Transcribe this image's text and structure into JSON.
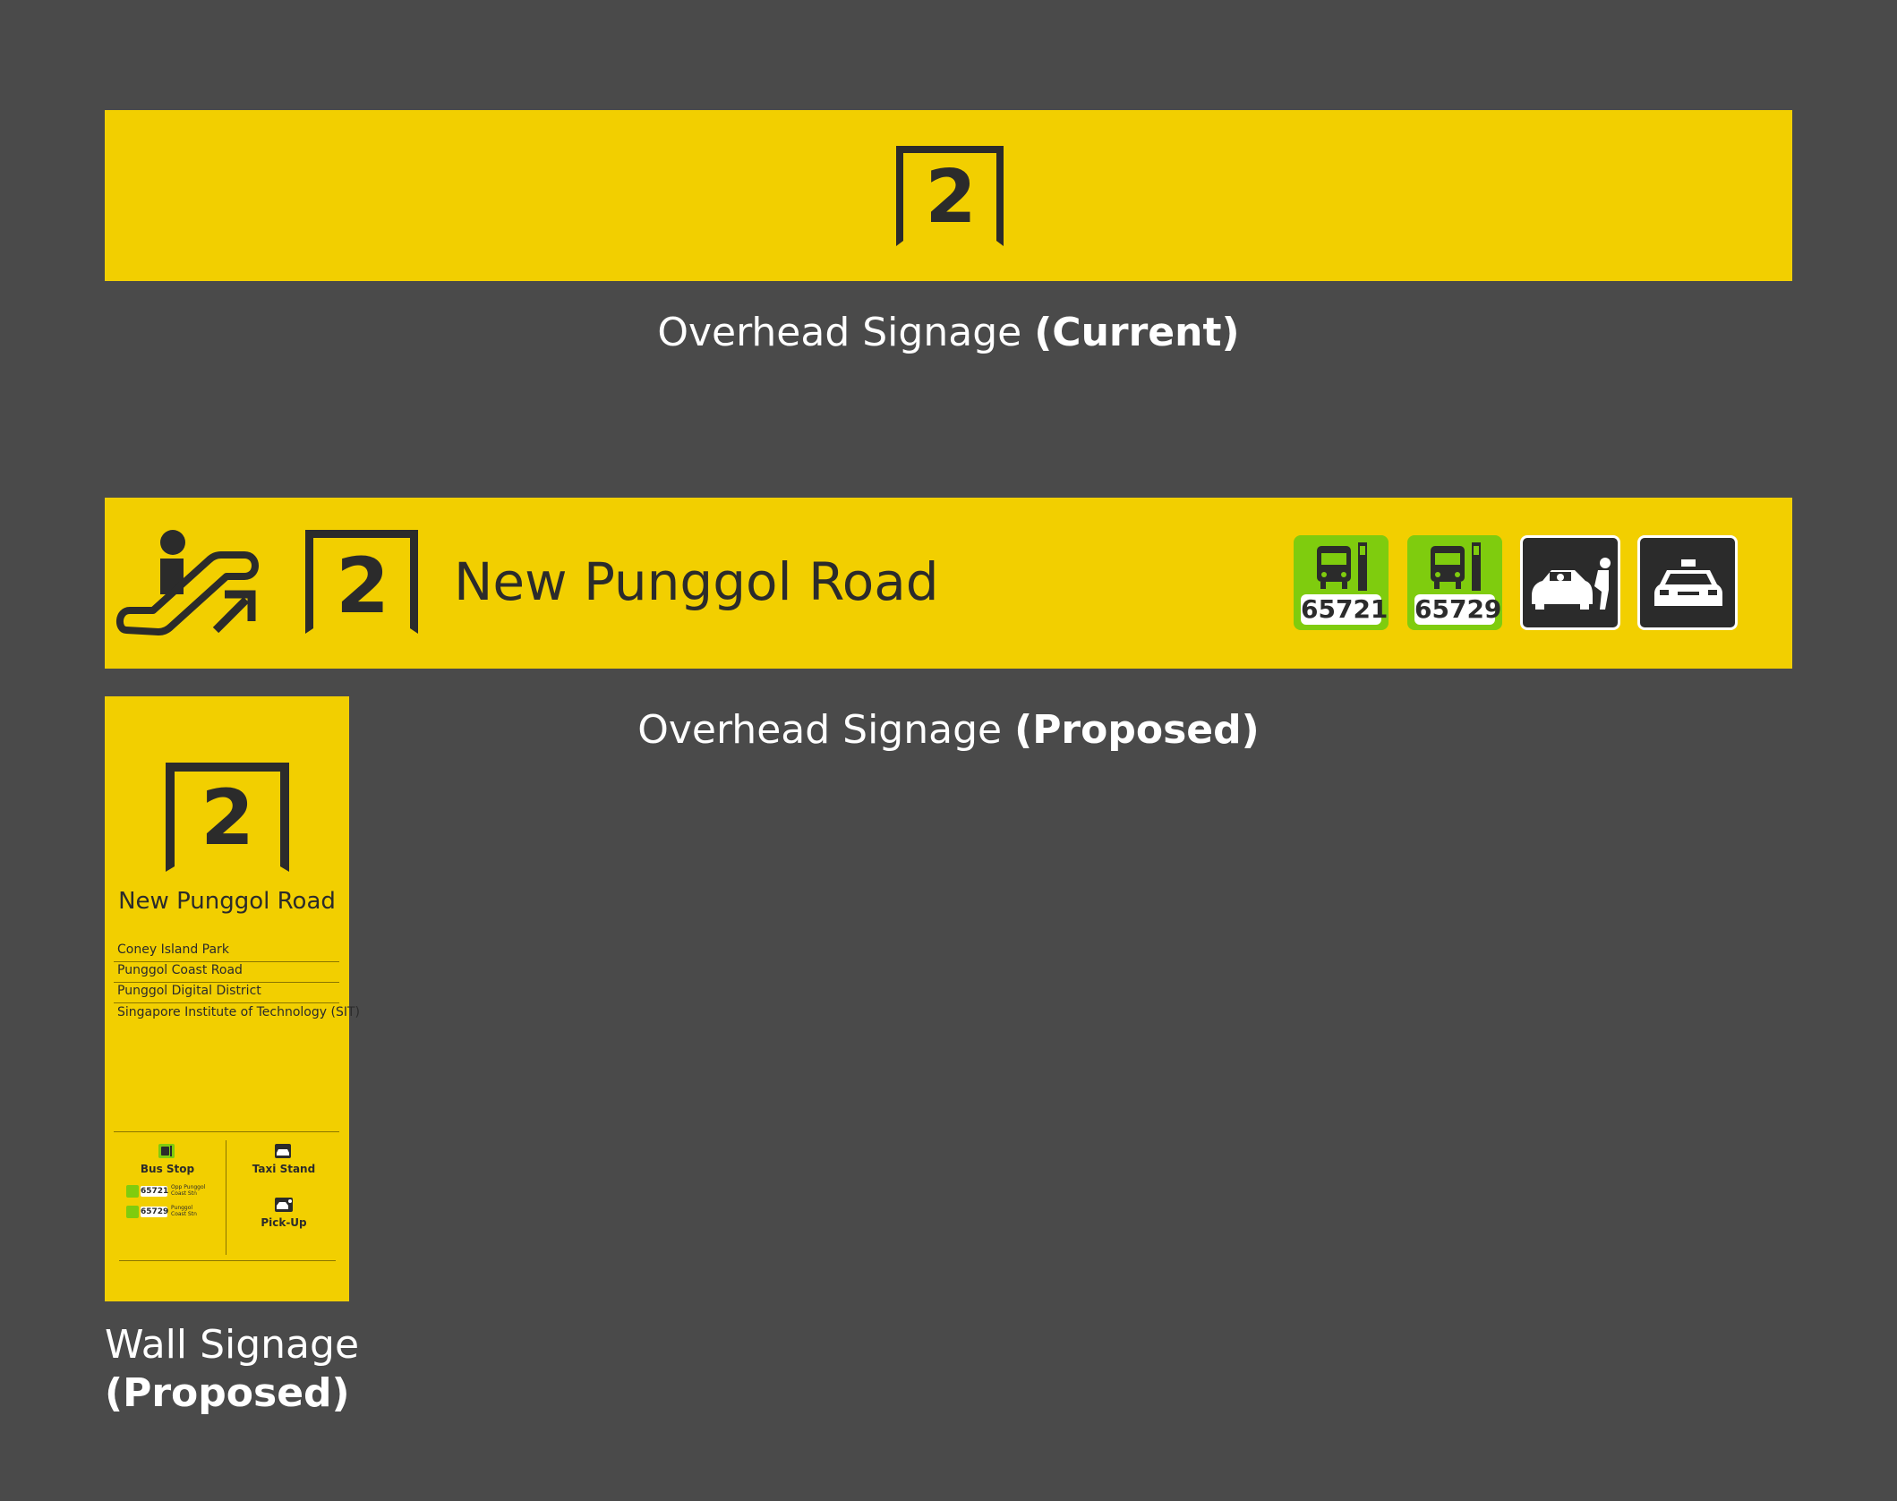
{
  "overhead_current": {
    "exit_number": "2",
    "caption_regular": "Overhead Signage ",
    "caption_bold": "(Current)"
  },
  "overhead_proposed": {
    "exit_number": "2",
    "road_name": "New Punggol Road",
    "bus_stops": [
      {
        "code": "65721"
      },
      {
        "code": "65729"
      }
    ],
    "caption_regular": "Overhead Signage ",
    "caption_bold": "(Proposed)"
  },
  "wall": {
    "exit_number": "2",
    "road_name": "New Punggol Road",
    "destinations": [
      "Coney Island Park",
      "Punggol Coast Road",
      "Punggol Digital District",
      "Singapore Institute of Technology (SIT)"
    ],
    "bus_stop_label": "Bus Stop",
    "bus_stops": [
      {
        "code": "65721",
        "name_line1": "Opp Punggol",
        "name_line2": "Coast Stn"
      },
      {
        "code": "65729",
        "name_line1": "Punggol",
        "name_line2": "Coast Stn"
      }
    ],
    "taxi_label": "Taxi Stand",
    "pickup_label": "Pick-Up",
    "caption_line1": "Wall Signage",
    "caption_line2": "(Proposed)"
  },
  "colors": {
    "background": "#4a4a4a",
    "sign_yellow": "#f2cf00",
    "ink": "#2b2b2b",
    "bus_green": "#7fcc0e"
  },
  "icons": [
    "exit-portal-icon",
    "escalator-up-icon",
    "bus-stop-icon",
    "pickup-car-icon",
    "taxi-icon"
  ]
}
